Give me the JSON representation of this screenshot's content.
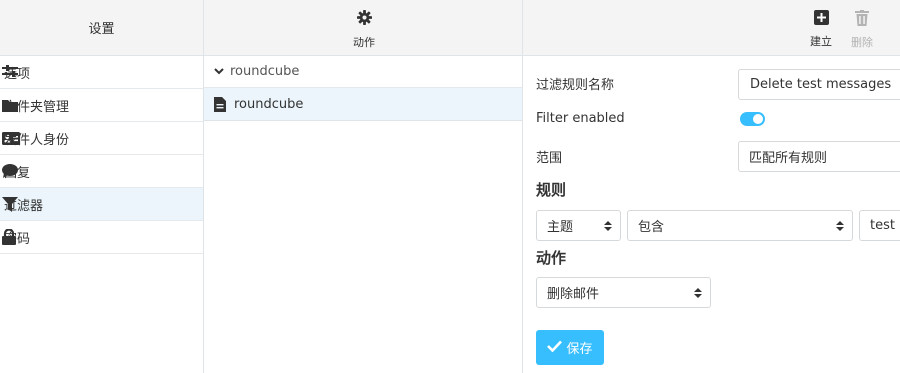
{
  "settings_column": {
    "title": "设置",
    "menu": [
      {
        "label": "选项",
        "icon": "sliders-icon"
      },
      {
        "label": "文件夹管理",
        "icon": "folder-icon"
      },
      {
        "label": "发件人身份",
        "icon": "id-card-icon"
      },
      {
        "label": "回复",
        "icon": "speech-bubble-icon"
      },
      {
        "label": "过滤器",
        "icon": "filter-icon",
        "selected": true
      },
      {
        "label": "密码",
        "icon": "lock-icon"
      }
    ]
  },
  "filters_column": {
    "action_label": "动作",
    "filter_set": "roundcube",
    "filters": [
      {
        "label": "roundcube",
        "selected": true
      }
    ]
  },
  "editor": {
    "toolbar": {
      "create_label": "建立",
      "delete_label": "删除"
    },
    "name_label": "过滤规则名称",
    "name_value": "Delete test messages",
    "enabled_label": "Filter enabled",
    "enabled": true,
    "scope_label": "范围",
    "scope_value": "匹配所有规则",
    "rules_title": "规则",
    "rule": {
      "header": "主题",
      "operator": "包含",
      "value": "test"
    },
    "actions_title": "动作",
    "action_value": "删除邮件",
    "save_label": "保存",
    "accent_color": "#37beff"
  }
}
